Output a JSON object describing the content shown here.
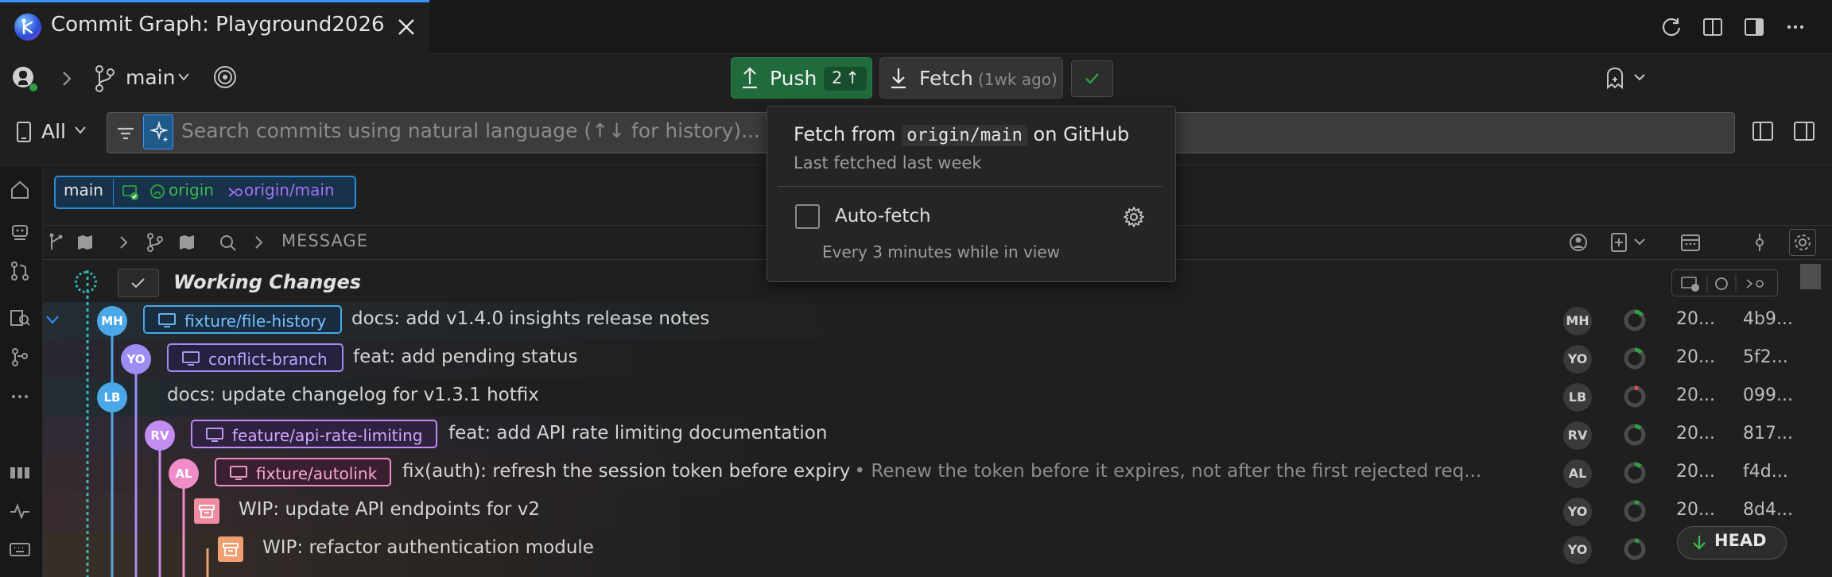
{
  "tab": {
    "title": "Commit Graph: Playground2026"
  },
  "header": {
    "branch": "main",
    "push_label": "Push",
    "push_count": "2",
    "fetch_label": "Fetch",
    "fetch_time": "(1wk ago)"
  },
  "search": {
    "scope": "All",
    "placeholder": "Search commits using natural language (↑↓ for history)..."
  },
  "branch_pill": {
    "local": "main",
    "remote": "origin",
    "upstream": "origin/main"
  },
  "columns": {
    "message": "MESSAGE"
  },
  "working_changes": "Working Changes",
  "commits": [
    {
      "initials": "MH",
      "branch": "fixture/file-history",
      "message": "docs: add v1.4.0 insights release notes",
      "detail": "",
      "author": "MH",
      "date": "20...",
      "sha": "4b9..."
    },
    {
      "initials": "YO",
      "branch": "conflict-branch",
      "message": "feat: add pending status",
      "detail": "",
      "author": "YO",
      "date": "20...",
      "sha": "5f2..."
    },
    {
      "initials": "LB",
      "branch": "",
      "message": "docs: update changelog for v1.3.1 hotfix",
      "detail": "",
      "author": "LB",
      "date": "20...",
      "sha": "099..."
    },
    {
      "initials": "RV",
      "branch": "feature/api-rate-limiting",
      "message": "feat: add API rate limiting documentation",
      "detail": "",
      "author": "RV",
      "date": "20...",
      "sha": "817..."
    },
    {
      "initials": "AL",
      "branch": "fixture/autolink",
      "message": "fix(auth): refresh the session token before expiry",
      "detail": "• Renew the token before it expires, not after the first rejected req...",
      "author": "AL",
      "date": "20...",
      "sha": "f4d..."
    },
    {
      "initials": "",
      "branch": "",
      "message": "WIP: update API endpoints for v2",
      "detail": "",
      "author": "YO",
      "date": "20...",
      "sha": "8d4..."
    },
    {
      "initials": "",
      "branch": "",
      "message": "WIP: refactor authentication module",
      "detail": "",
      "author": "YO",
      "date": "",
      "sha": ""
    }
  ],
  "popup": {
    "title_prefix": "Fetch from",
    "title_code": "origin/main",
    "title_suffix": "on GitHub",
    "subtitle": "Last fetched last week",
    "autofetch_label": "Auto-fetch",
    "autofetch_note": "Every 3 minutes while in view"
  },
  "head_button": "HEAD",
  "colors": {
    "accent": "#3794ff",
    "push": "#1f6b3c",
    "lane_blue": "#4aa8e8",
    "lane_purple": "#9f8cf2",
    "lane_violet": "#c28cf0",
    "lane_pink": "#f08cc8",
    "lane_orange": "#f0a070"
  }
}
